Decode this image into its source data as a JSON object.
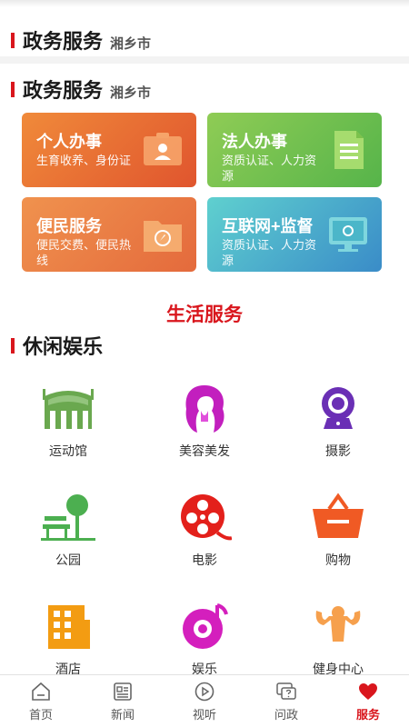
{
  "sticky_header": {
    "title": "政务服务",
    "city": "湘乡市"
  },
  "gov_section": {
    "title": "政务服务",
    "city": "湘乡市"
  },
  "cards": [
    {
      "title": "个人办事",
      "desc": "生育收养、身份证",
      "icon": "id-card-icon"
    },
    {
      "title": "法人办事",
      "desc": "资质认证、人力资源",
      "icon": "document-icon"
    },
    {
      "title": "便民服务",
      "desc": "便民交费、便民热线",
      "icon": "folder-compass-icon"
    },
    {
      "title": "互联网+监督",
      "desc": "资质认证、人力资源",
      "icon": "monitor-icon"
    }
  ],
  "life_title": "生活服务",
  "leisure_section": {
    "title": "休闲娱乐"
  },
  "leisure_items": [
    {
      "label": "运动馆",
      "icon": "stadium-icon"
    },
    {
      "label": "美容美发",
      "icon": "beauty-salon-icon"
    },
    {
      "label": "摄影",
      "icon": "camera-icon"
    },
    {
      "label": "公园",
      "icon": "park-icon"
    },
    {
      "label": "电影",
      "icon": "film-reel-icon"
    },
    {
      "label": "购物",
      "icon": "shopping-basket-icon"
    },
    {
      "label": "酒店",
      "icon": "hotel-icon"
    },
    {
      "label": "娱乐",
      "icon": "music-disc-icon"
    },
    {
      "label": "健身中心",
      "icon": "fitness-icon"
    }
  ],
  "tabbar": [
    {
      "label": "首页",
      "icon": "home-icon",
      "active": false
    },
    {
      "label": "新闻",
      "icon": "news-icon",
      "active": false
    },
    {
      "label": "视听",
      "icon": "play-icon",
      "active": false
    },
    {
      "label": "问政",
      "icon": "question-chat-icon",
      "active": false
    },
    {
      "label": "服务",
      "icon": "heart-icon",
      "active": true
    }
  ],
  "colors": {
    "accent": "#d9161d",
    "orange": "#e0552e",
    "green": "#56b44a",
    "teal": "#3a8cc8"
  }
}
